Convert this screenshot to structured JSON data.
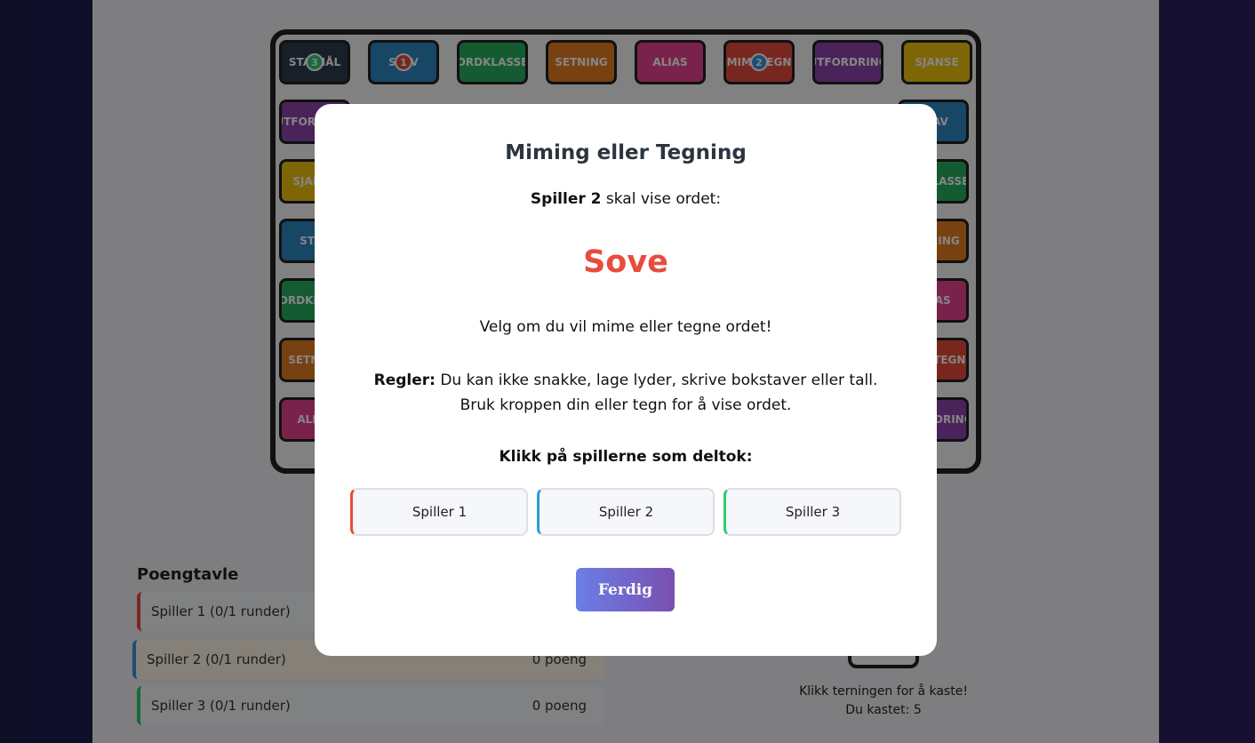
{
  "board": {
    "tiles": [
      {
        "label": "STA MÅL",
        "color": "#2c3e50"
      },
      {
        "label": "STAV",
        "color": "#2e86c1"
      },
      {
        "label": "ORDKLASSE",
        "color": "#27ae60"
      },
      {
        "label": "SETNING",
        "color": "#e67e22"
      },
      {
        "label": "ALIAS",
        "color": "#e84393"
      },
      {
        "label": "MIMETEGN",
        "color": "#e74c3c"
      },
      {
        "label": "UTFORDRING",
        "color": "#8e44ad"
      },
      {
        "label": "SJANSE",
        "color": "#f1c40f"
      },
      {
        "label": "STAV",
        "color": "#2e86c1"
      },
      {
        "label": "ORDKLASSE",
        "color": "#27ae60"
      },
      {
        "label": "SETNING",
        "color": "#e67e22"
      },
      {
        "label": "ALIAS",
        "color": "#e84393"
      },
      {
        "label": "MIMETEGN",
        "color": "#e74c3c"
      },
      {
        "label": "UTFORDRING",
        "color": "#8e44ad"
      },
      {
        "label": "UTFORDRING",
        "color": "#8e44ad"
      },
      {
        "label": "SJANSE",
        "color": "#f1c40f"
      },
      {
        "label": "STAV",
        "color": "#2e86c1"
      },
      {
        "label": "ORDKLASSE",
        "color": "#27ae60"
      },
      {
        "label": "SETNING",
        "color": "#e67e22"
      },
      {
        "label": "ALIAS",
        "color": "#e84393"
      }
    ],
    "tokens": [
      {
        "label": "3",
        "color": "#2ecc71",
        "tile": 0
      },
      {
        "label": "1",
        "color": "#e74c3c",
        "tile": 1
      },
      {
        "label": "2",
        "color": "#3498db",
        "tile": 5
      }
    ]
  },
  "scoreboard": {
    "title": "Poengtavle",
    "rows": [
      {
        "name": "Spiller 1 (0/1 runder)",
        "points": "",
        "color": "#e74c3c"
      },
      {
        "name": "Spiller 2 (0/1 runder)",
        "points": "0 poeng",
        "color": "#3498db"
      },
      {
        "name": "Spiller 3 (0/1 runder)",
        "points": "0 poeng",
        "color": "#2ecc71"
      }
    ]
  },
  "dice": {
    "hint": "Klikk terningen for å kaste!",
    "result": "Du kastet: 5"
  },
  "modal": {
    "title": "Miming eller Tegning",
    "prompt_player": "Spiller 2",
    "prompt_rest": " skal vise ordet:",
    "word": "Sove",
    "instruction": "Velg om du vil mime eller tegne ordet!",
    "rules_label": "Regler:",
    "rules_text": " Du kan ikke snakke, lage lyder, skrive bokstaver eller tall. Bruk kroppen din eller tegn for å vise ordet.",
    "participants_label": "Klikk på spillerne som deltok:",
    "players": [
      {
        "label": "Spiller 1",
        "color": "#e74c3c"
      },
      {
        "label": "Spiller 2",
        "color": "#3498db"
      },
      {
        "label": "Spiller 3",
        "color": "#2ecc71"
      }
    ],
    "done_label": "Ferdig"
  }
}
